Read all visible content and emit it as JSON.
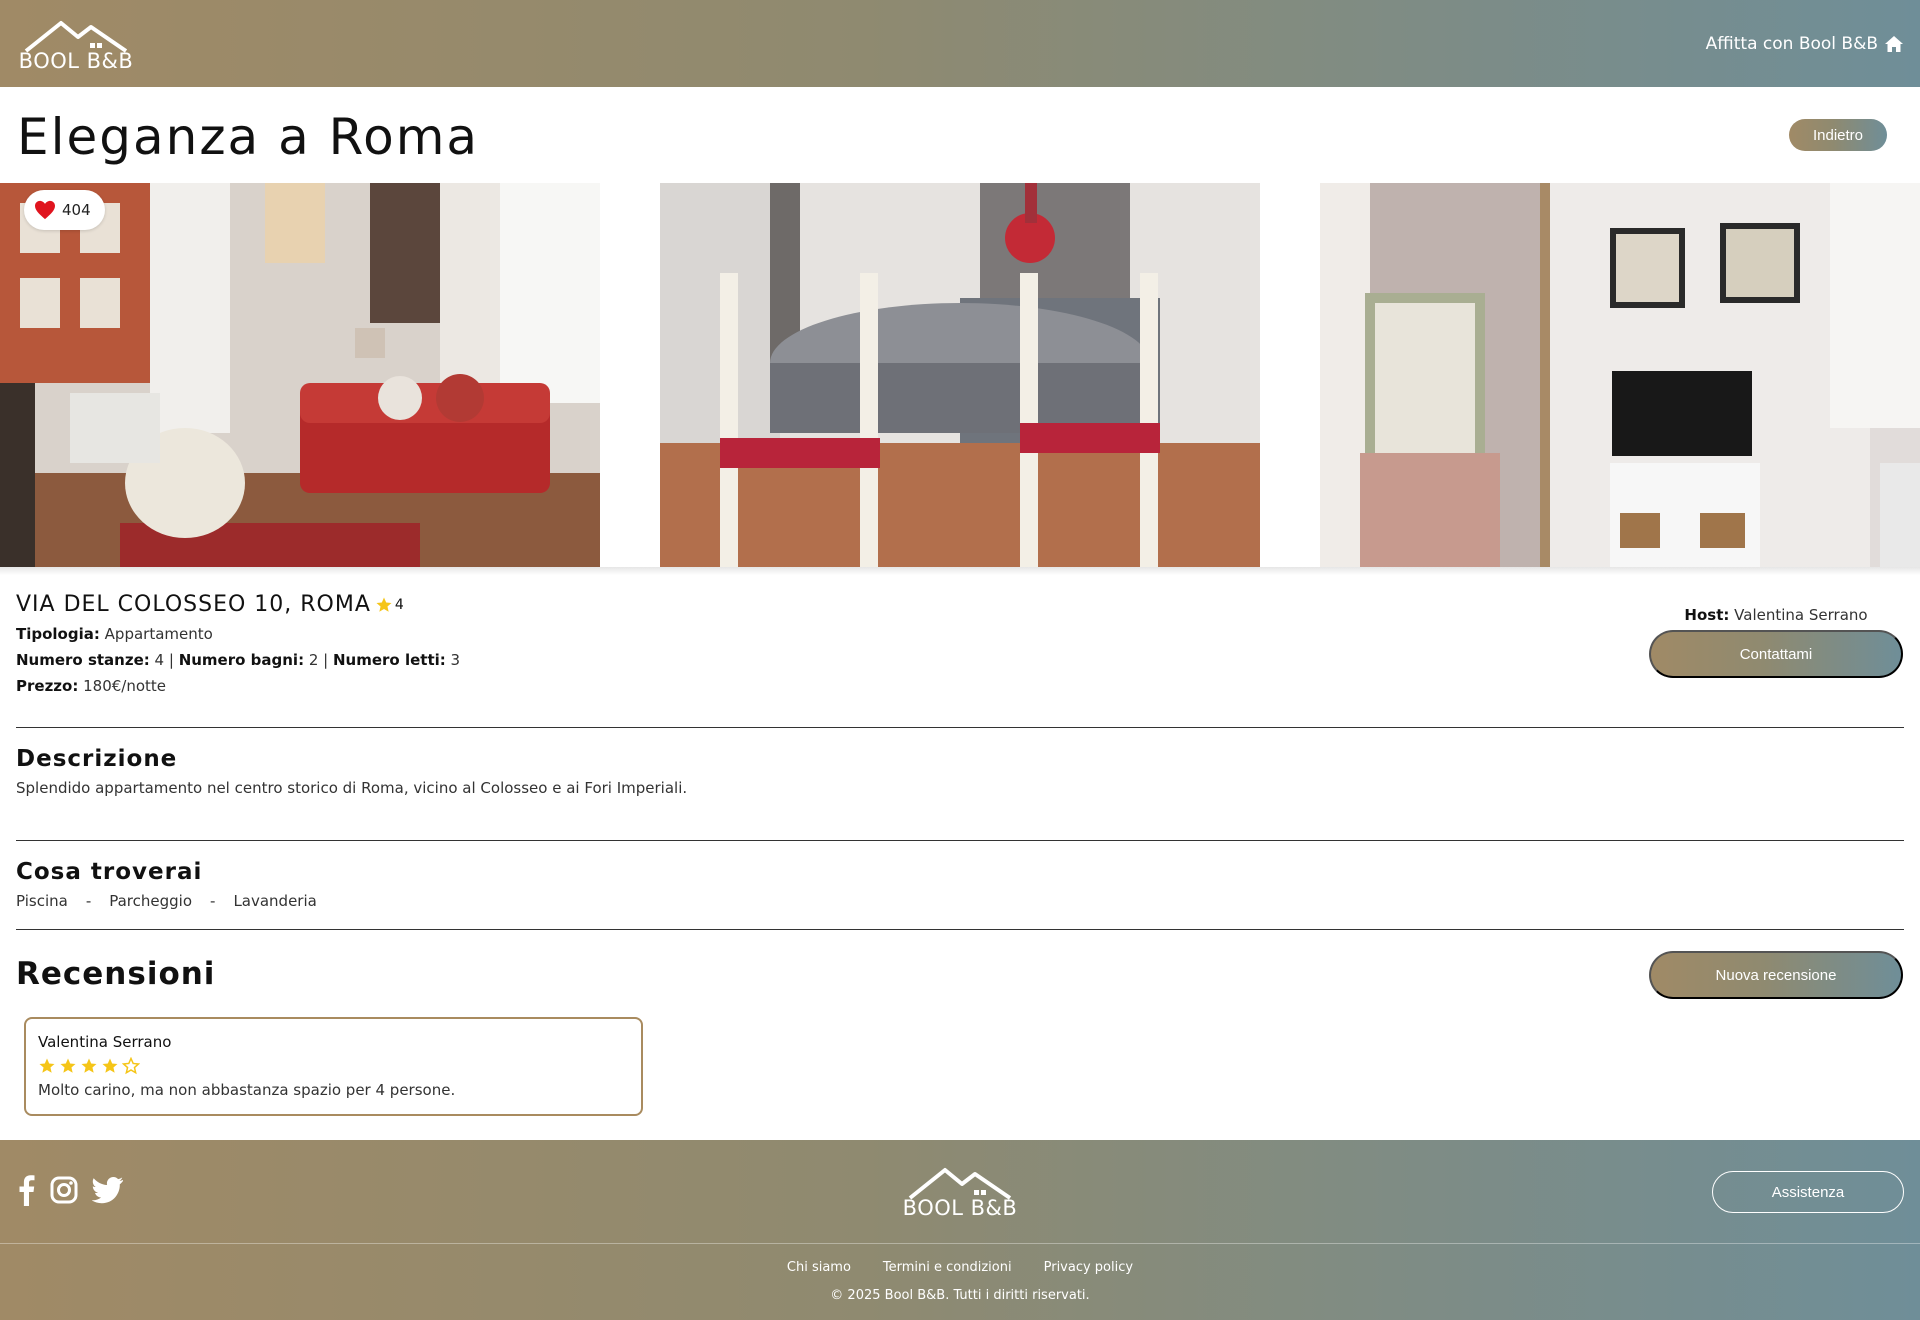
{
  "header": {
    "logo_text": "BOOL B&B",
    "rent_link": "Affitta con Bool B&B"
  },
  "listing": {
    "title": "Eleganza a Roma",
    "back_label": "Indietro",
    "likes": "404",
    "address": "VIA DEL COLOSSEO 10, ROMA",
    "rating": "4",
    "type_label": "Tipologia:",
    "type_value": "Appartamento",
    "rooms_label": "Numero stanze:",
    "rooms_value": "4",
    "baths_label": "Numero bagni:",
    "baths_value": "2",
    "beds_label": "Numero letti:",
    "beds_value": "3",
    "price_label": "Prezzo:",
    "price_value": "180€/notte",
    "host_label": "Host:",
    "host_name": "Valentina Serrano",
    "contact_label": "Contattami"
  },
  "description": {
    "title": "Descrizione",
    "text": "Splendido appartamento nel centro storico di Roma, vicino al Colosseo e ai Fori Imperiali."
  },
  "amenities": {
    "title": "Cosa troverai",
    "separator": "-",
    "items": [
      "Piscina",
      "Parcheggio",
      "Lavanderia"
    ]
  },
  "reviews": {
    "title": "Recensioni",
    "new_label": "Nuova recensione",
    "items": [
      {
        "author": "Valentina Serrano",
        "stars": 4,
        "max_stars": 5,
        "text": "Molto carino, ma non abbastanza spazio per 4 persone."
      }
    ]
  },
  "footer": {
    "logo_text": "BOOL B&B",
    "assist_label": "Assistenza",
    "links": [
      "Chi siamo",
      "Termini e condizioni",
      "Privacy policy"
    ],
    "copyright": "© 2025 Bool B&B. Tutti i diritti riservati."
  },
  "colors": {
    "brand_gradient_start": "#a08a66",
    "brand_gradient_end": "#6f8e98",
    "star": "#f5c518",
    "heart": "#e0141e",
    "review_border": "#a98b5f"
  }
}
